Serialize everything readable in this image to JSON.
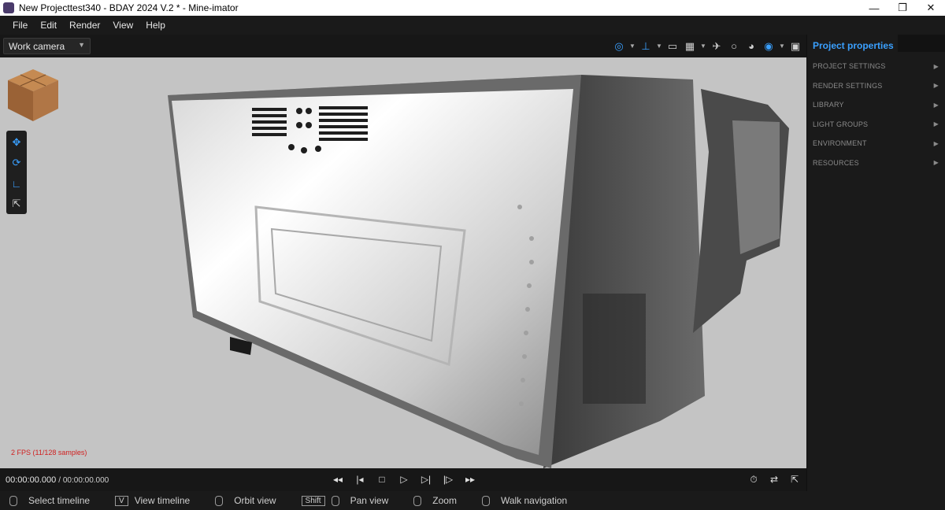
{
  "window": {
    "title": "New Projecttest340 - BDAY 2024 V.2 *  - Mine-imator",
    "min_icon": "minimize-icon",
    "max_icon": "restore-icon",
    "close_icon": "close-icon"
  },
  "menu": [
    "File",
    "Edit",
    "Render",
    "View",
    "Help"
  ],
  "viewport": {
    "camera_select": "Work camera",
    "fps": "2 FPS (11/128 samples)"
  },
  "right_panel": {
    "tab": "Project properties",
    "sections": [
      "PROJECT SETTINGS",
      "RENDER SETTINGS",
      "LIBRARY",
      "LIGHT GROUPS",
      "ENVIRONMENT",
      "RESOURCES"
    ]
  },
  "timeline": {
    "current": "00:00:00.000",
    "total": "/ 00:00:00.000"
  },
  "status": {
    "select_timeline": "Select timeline",
    "view_timeline_key": "V",
    "view_timeline": "View timeline",
    "orbit_view": "Orbit view",
    "pan_key": "Shift",
    "pan_view": "Pan view",
    "zoom": "Zoom",
    "walk_navigation": "Walk navigation"
  },
  "colors": {
    "accent": "#3aa0ff",
    "fps_text": "#d02020",
    "viewport_bg": "#c6c6c6"
  }
}
